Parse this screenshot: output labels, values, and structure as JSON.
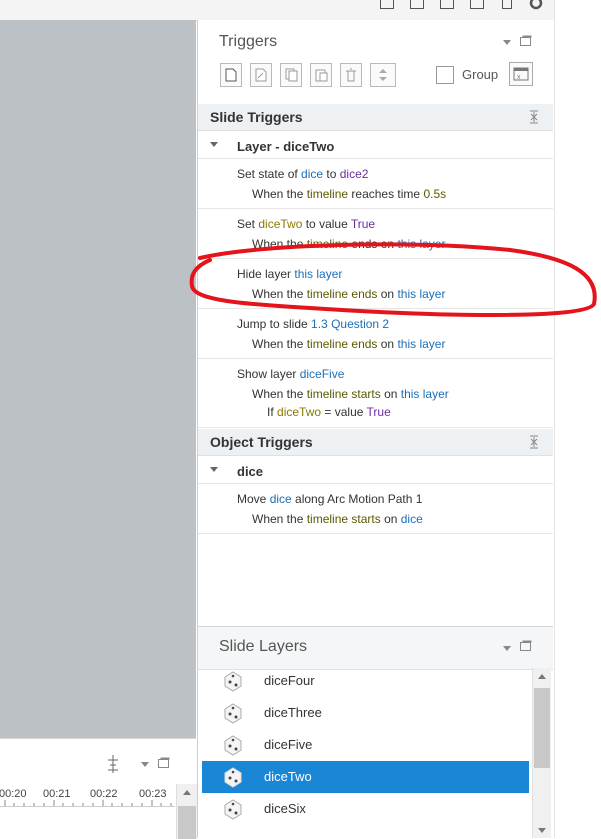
{
  "triggers_panel": {
    "title": "Triggers",
    "group_label": "Group"
  },
  "slide_triggers": {
    "header": "Slide Triggers",
    "group": "Layer - diceTwo",
    "items": [
      {
        "action": [
          "Set state of ",
          "dice",
          " to ",
          "dice2"
        ],
        "condition": [
          "When the ",
          "timeline",
          " reaches time ",
          "0.5s"
        ]
      },
      {
        "action": [
          "Set ",
          "diceTwo",
          " to value ",
          "True"
        ],
        "condition": [
          "When the ",
          "timeline",
          " ends on ",
          "this layer"
        ]
      },
      {
        "action": [
          "Hide layer ",
          "this layer"
        ],
        "condition": [
          "When the ",
          "timeline",
          " ends",
          " on ",
          "this layer"
        ]
      },
      {
        "action": [
          "Jump to slide ",
          "1.3 Question 2"
        ],
        "condition": [
          "When the ",
          "timeline",
          " ends",
          " on ",
          "this layer"
        ]
      },
      {
        "action": [
          "Show layer ",
          "diceFive"
        ],
        "condition": [
          "When the ",
          "timeline",
          " starts",
          " on ",
          "this layer"
        ],
        "extra": [
          "If ",
          "diceTwo",
          " = value ",
          "True"
        ]
      }
    ]
  },
  "object_triggers": {
    "header": "Object Triggers",
    "group": "dice",
    "items": [
      {
        "action": [
          "Move ",
          "dice",
          " along Arc Motion Path 1"
        ],
        "condition": [
          "When the ",
          "timeline",
          " starts",
          " on ",
          "dice"
        ]
      }
    ]
  },
  "slide_layers": {
    "title": "Slide Layers",
    "layers": [
      "diceFour",
      "diceThree",
      "diceFive",
      "diceTwo",
      "diceSix"
    ],
    "selected": "diceTwo"
  },
  "timeline": {
    "ticks": [
      "00:20",
      "00:21",
      "00:22",
      "00:23"
    ]
  },
  "colors": {
    "selection": "#1a86d6",
    "annotation": "#e3141b",
    "stage": "#bcc1c5"
  }
}
